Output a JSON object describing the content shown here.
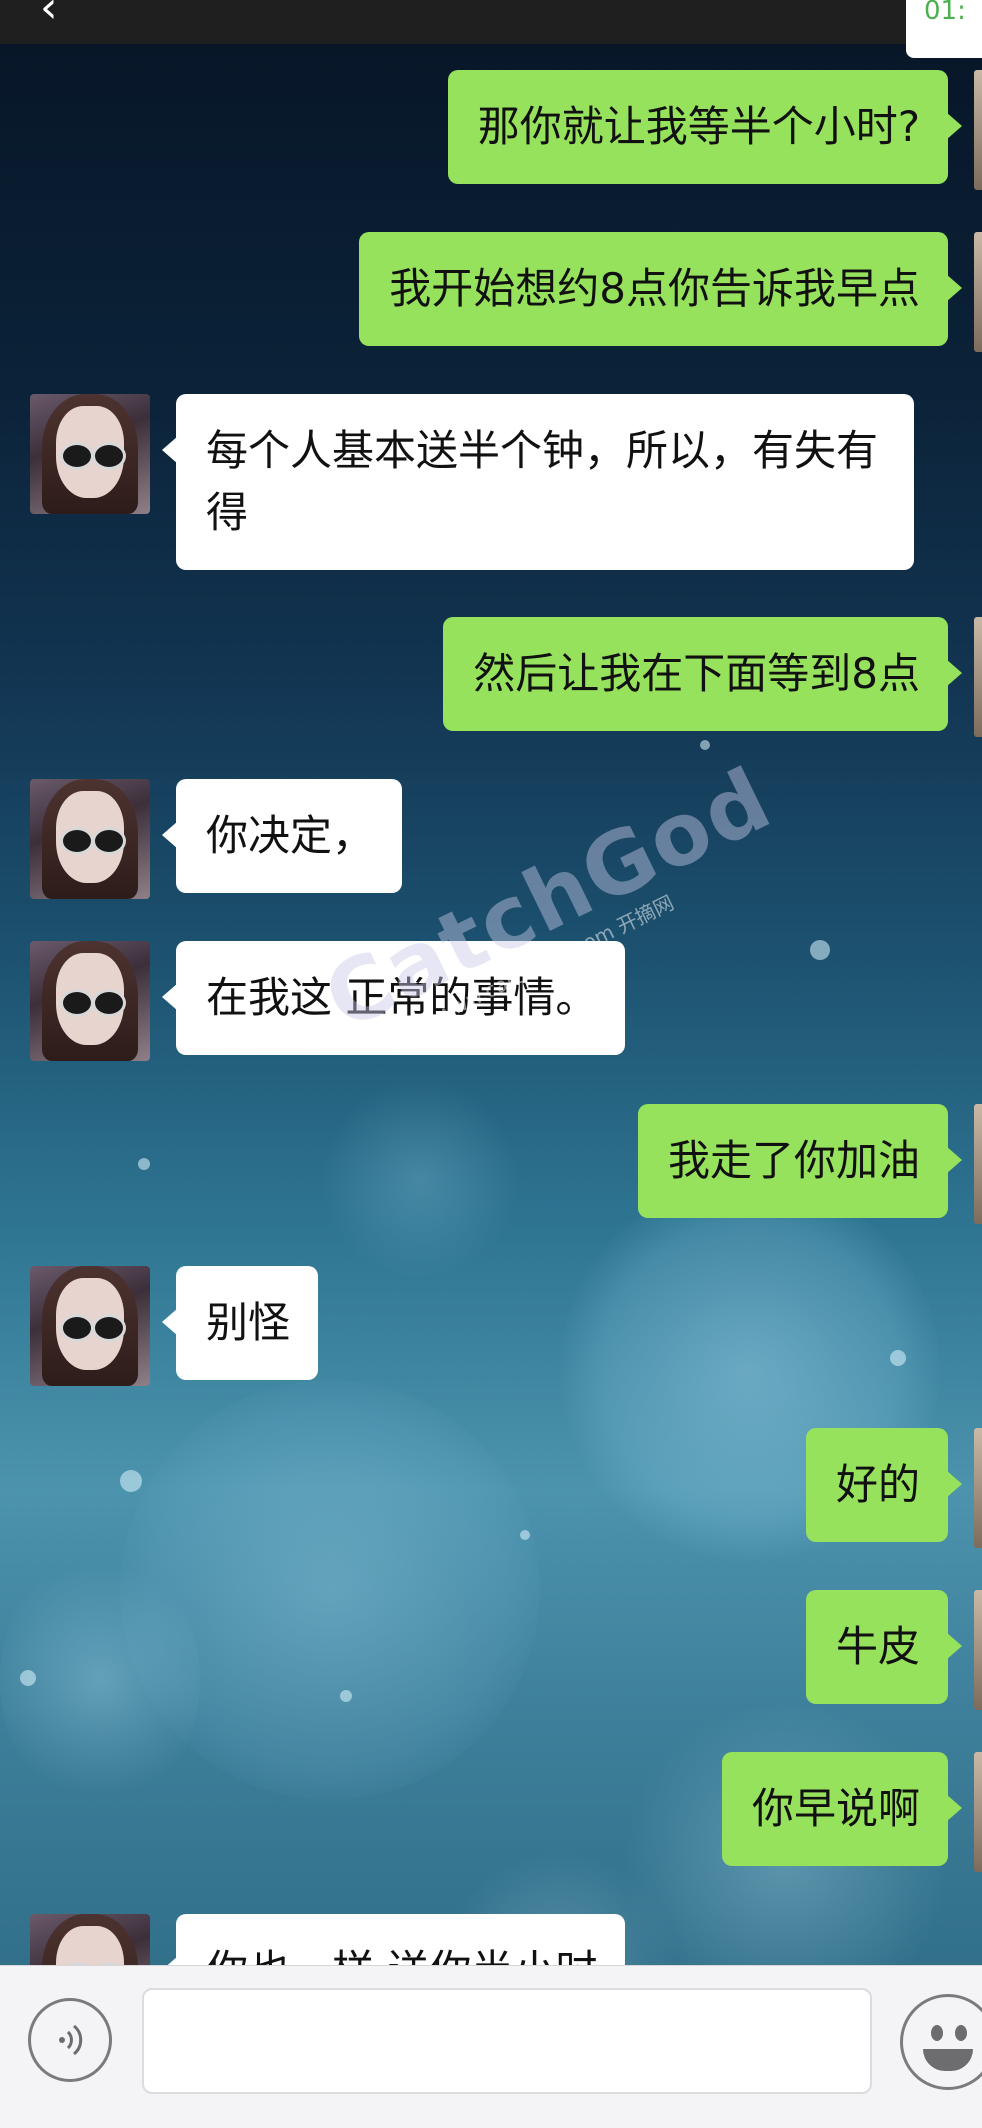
{
  "topbar": {
    "back_icon": "chevron-left-icon",
    "timer_text": "01:"
  },
  "messages": [
    {
      "side": "out",
      "text": "那你就让我等半个小时?"
    },
    {
      "side": "out",
      "text": "我开始想约8点你告诉我早点"
    },
    {
      "side": "in",
      "text": "每个人基本送半个钟，所以，有失有得"
    },
    {
      "side": "out",
      "text": "然后让我在下面等到8点"
    },
    {
      "side": "in",
      "text": "你决定，"
    },
    {
      "side": "in",
      "text": "在我这 正常的事情。"
    },
    {
      "side": "out",
      "text": "我走了你加油"
    },
    {
      "side": "in",
      "text": "别怪"
    },
    {
      "side": "out",
      "text": "好的"
    },
    {
      "side": "out",
      "text": "牛皮"
    },
    {
      "side": "out",
      "text": "你早说啊"
    },
    {
      "side": "in",
      "text": "你也一样 送你半小时"
    }
  ],
  "watermark": {
    "brand": "CatchGod",
    "url": "www.catchgod.com 开摘网"
  },
  "inputbar": {
    "voice_icon": "voice-icon",
    "input_value": "",
    "emoji_icon": "emoji-icon"
  }
}
